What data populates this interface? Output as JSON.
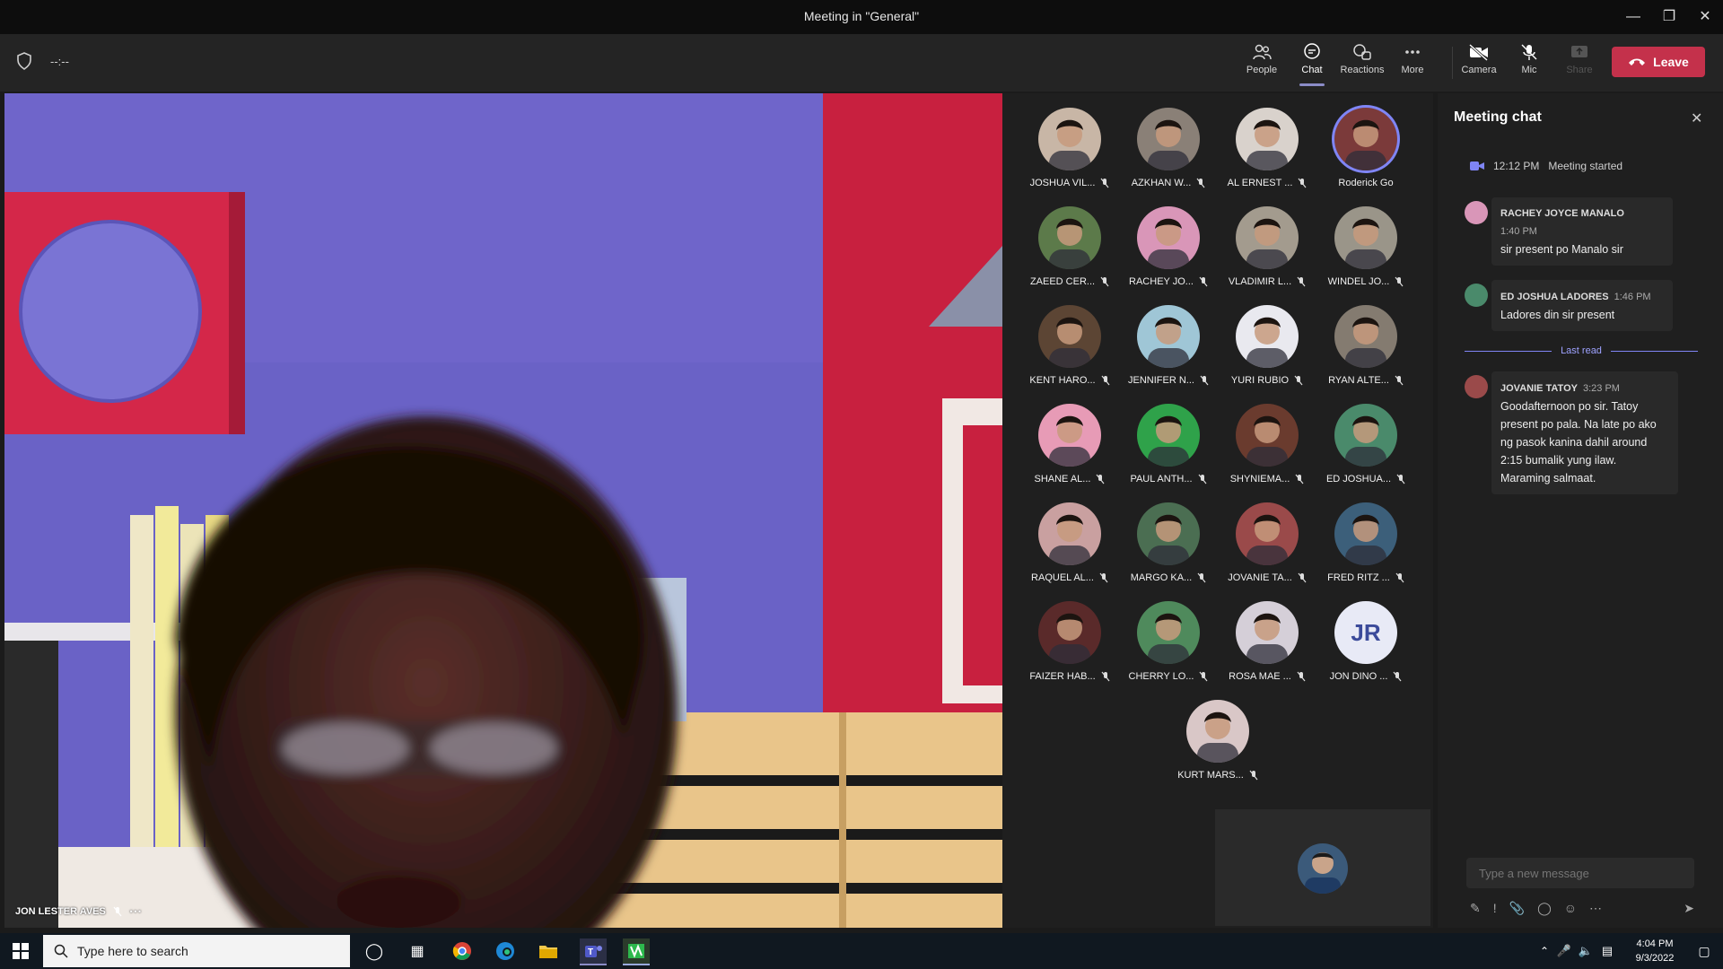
{
  "window": {
    "title": "Meeting in \"General\"",
    "timer": "--:--"
  },
  "toolbar": {
    "people": "People",
    "chat": "Chat",
    "reactions": "Reactions",
    "more": "More",
    "camera": "Camera",
    "mic": "Mic",
    "share": "Share",
    "leave": "Leave"
  },
  "main_video": {
    "name": "JON LESTER AVES"
  },
  "participants": [
    {
      "name": "JOSHUA VIL...",
      "color": "#c8b6a6"
    },
    {
      "name": "AZKHAN W...",
      "color": "#8a8077"
    },
    {
      "name": "AL ERNEST ...",
      "color": "#d9d2cc"
    },
    {
      "name": "Roderick Go",
      "color": "#7b3a3a",
      "speaking": true
    },
    {
      "name": "ZAEED CER...",
      "color": "#5c7a4a"
    },
    {
      "name": "RACHEY JO...",
      "color": "#d996b8"
    },
    {
      "name": "VLADIMIR L...",
      "color": "#a39b8e"
    },
    {
      "name": "WINDEL JO...",
      "color": "#9a9589"
    },
    {
      "name": "KENT HARO...",
      "color": "#5c4534"
    },
    {
      "name": "JENNIFER N...",
      "color": "#9fc6d6"
    },
    {
      "name": "YURI RUBIO",
      "color": "#e9e9ef"
    },
    {
      "name": "RYAN ALTE...",
      "color": "#847b70"
    },
    {
      "name": "SHANE AL...",
      "color": "#e79bb6"
    },
    {
      "name": "PAUL ANTH...",
      "color": "#2fa24a"
    },
    {
      "name": "SHYNIEMA...",
      "color": "#6a3b2e"
    },
    {
      "name": "ED JOSHUA...",
      "color": "#4a8a6b"
    },
    {
      "name": "RAQUEL AL...",
      "color": "#c9a0a0"
    },
    {
      "name": "MARGO KA...",
      "color": "#4b6e52"
    },
    {
      "name": "JOVANIE TA...",
      "color": "#9a4a4a"
    },
    {
      "name": "FRED RITZ ...",
      "color": "#3c5f7a"
    },
    {
      "name": "FAIZER HAB...",
      "color": "#5a2a2a"
    },
    {
      "name": "CHERRY LO...",
      "color": "#4f8a5c"
    },
    {
      "name": "ROSA MAE ...",
      "color": "#d5cfd8"
    },
    {
      "name": "JON DINO ...",
      "initials": "JR"
    },
    {
      "name": "KURT MARS...",
      "color": "#d9c7c7"
    }
  ],
  "chat": {
    "title": "Meeting chat",
    "system": {
      "time": "12:12 PM",
      "text": "Meeting started"
    },
    "messages": [
      {
        "author": "RACHEY JOYCE MANALO",
        "time": "1:40 PM",
        "text": "sir present po Manalo sir"
      },
      {
        "author": "ED JOSHUA LADORES",
        "time": "1:46 PM",
        "text": "Ladores din sir present"
      },
      {
        "author": "JOVANIE TATOY",
        "time": "3:23 PM",
        "text": "Goodafternoon po sir. Tatoy present po pala. Na late po ako ng pasok kanina dahil around 2:15 bumalik yung ilaw. Maraming salmaat."
      }
    ],
    "last_read": "Last read",
    "input_placeholder": "Type a new message"
  },
  "taskbar": {
    "search_placeholder": "Type here to search",
    "time": "4:04 PM",
    "date": "9/3/2022"
  }
}
